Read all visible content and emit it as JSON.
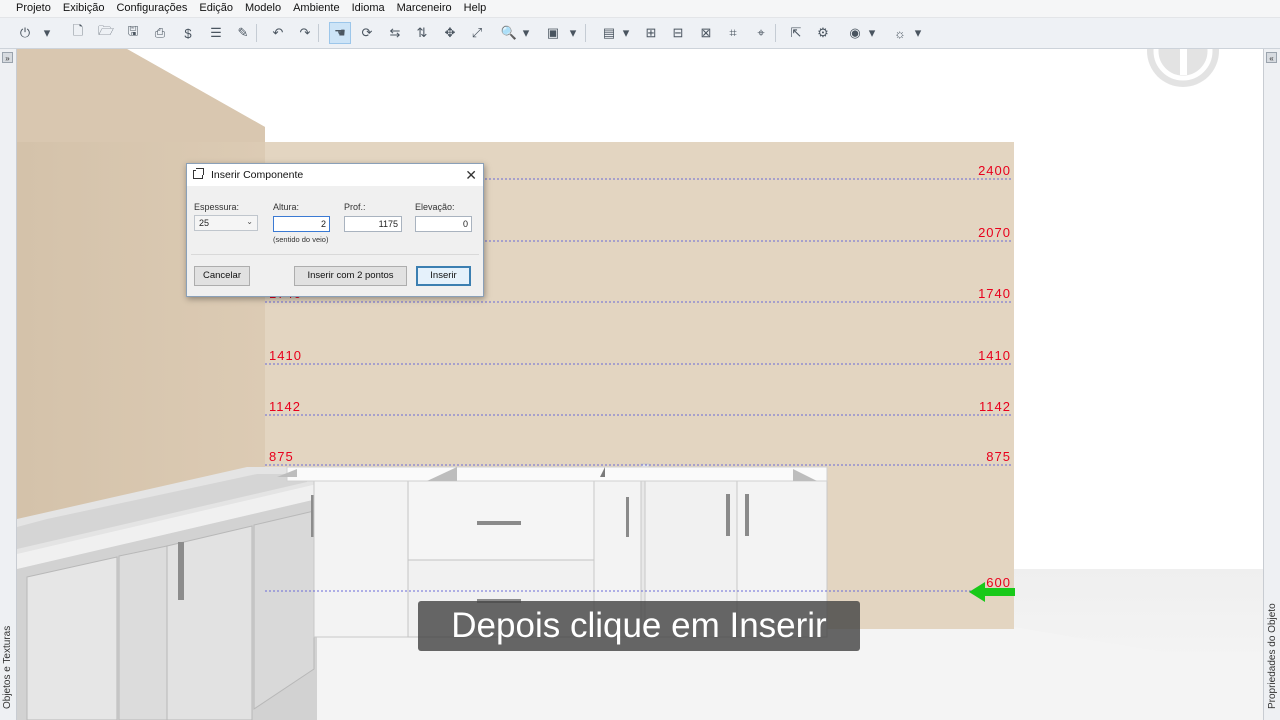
{
  "menu": {
    "items": [
      "Projeto",
      "Exibição",
      "Configurações",
      "Edição",
      "Modelo",
      "Ambiente",
      "Idioma",
      "Marceneiro",
      "Help"
    ]
  },
  "toolbar": {
    "tools": [
      {
        "icon": "app-logo-icon",
        "glyph": "⏻"
      },
      {
        "icon": "dropdown-arrow-icon",
        "glyph": "▾"
      },
      {
        "icon": "new-file-icon",
        "glyph": "🗋"
      },
      {
        "icon": "open-file-icon",
        "glyph": "🗁"
      },
      {
        "icon": "save-icon",
        "glyph": "🖫"
      },
      {
        "icon": "print-icon",
        "glyph": "⎙"
      },
      {
        "icon": "budget-dollar-icon",
        "glyph": "$"
      },
      {
        "icon": "report-icon",
        "glyph": "☰"
      },
      {
        "icon": "pencil-icon",
        "glyph": "✎"
      },
      {
        "icon": "undo-icon",
        "glyph": "↶"
      },
      {
        "icon": "redo-icon",
        "glyph": "↷"
      },
      {
        "icon": "hand-pan-icon",
        "glyph": "☚"
      },
      {
        "icon": "orbit-icon",
        "glyph": "⟳"
      },
      {
        "icon": "rotate-horizontal-icon",
        "glyph": "⇆"
      },
      {
        "icon": "rotate-vertical-icon",
        "glyph": "⇅"
      },
      {
        "icon": "move-icon",
        "glyph": "✥"
      },
      {
        "icon": "zoom-extents-icon",
        "glyph": "⤢"
      },
      {
        "icon": "zoom-icon",
        "glyph": "🔍"
      },
      {
        "icon": "dropdown-arrow-icon",
        "glyph": "▾"
      },
      {
        "icon": "view-cube-icon",
        "glyph": "▣"
      },
      {
        "icon": "dropdown-arrow-icon",
        "glyph": "▾"
      },
      {
        "icon": "layers-icon",
        "glyph": "▤"
      },
      {
        "icon": "dropdown-arrow-icon",
        "glyph": "▾"
      },
      {
        "icon": "measure-icon",
        "glyph": "⊞"
      },
      {
        "icon": "dimension-icon",
        "glyph": "⊟"
      },
      {
        "icon": "align-icon",
        "glyph": "⊠"
      },
      {
        "icon": "cut-icon",
        "glyph": "⌗"
      },
      {
        "icon": "select-icon",
        "glyph": "⌖"
      },
      {
        "icon": "cursor-icon",
        "glyph": "⇱"
      },
      {
        "icon": "gear-icon",
        "glyph": "⚙"
      },
      {
        "icon": "camera-icon",
        "glyph": "◉"
      },
      {
        "icon": "dropdown-arrow-icon",
        "glyph": "▾"
      },
      {
        "icon": "lamp-icon",
        "glyph": "☼"
      },
      {
        "icon": "dropdown-arrow-icon",
        "glyph": "▾"
      }
    ]
  },
  "side_panels": {
    "left_label": "Objetos e Texturas",
    "right_label": "Propriedades do Objeto",
    "left_toggle": "»",
    "right_toggle": "«"
  },
  "elevation_marks": [
    {
      "value": "2400",
      "left": false,
      "right": true
    },
    {
      "value": "2070",
      "left": false,
      "right": true
    },
    {
      "value": "1740",
      "left": true,
      "right": true
    },
    {
      "value": "1410",
      "left": true,
      "right": true
    },
    {
      "value": "1142",
      "left": true,
      "right": true
    },
    {
      "value": "875",
      "left": true,
      "right": true
    },
    {
      "value": "600",
      "left": false,
      "right": true
    }
  ],
  "dialog": {
    "title": "Inserir Componente",
    "espessura_label": "Espessura:",
    "espessura_value": "25",
    "altura_label": "Altura:",
    "altura_value": "2",
    "altura_hint": "(sentido do veio)",
    "prof_label": "Prof.:",
    "prof_value": "1175",
    "elevacao_label": "Elevação:",
    "elevacao_value": "0",
    "cancel_label": "Cancelar",
    "two_points_label": "Inserir com 2 pontos",
    "insert_label": "Inserir"
  },
  "caption": "Depois clique em Inserir",
  "colors": {
    "wall_back": "#e2d3bf",
    "wall_left": "#d8c6ae",
    "floor": "#f2f2f2",
    "mark_text": "#e8001c",
    "mark_line": "#6a6ad8",
    "arrow": "#19c919"
  }
}
